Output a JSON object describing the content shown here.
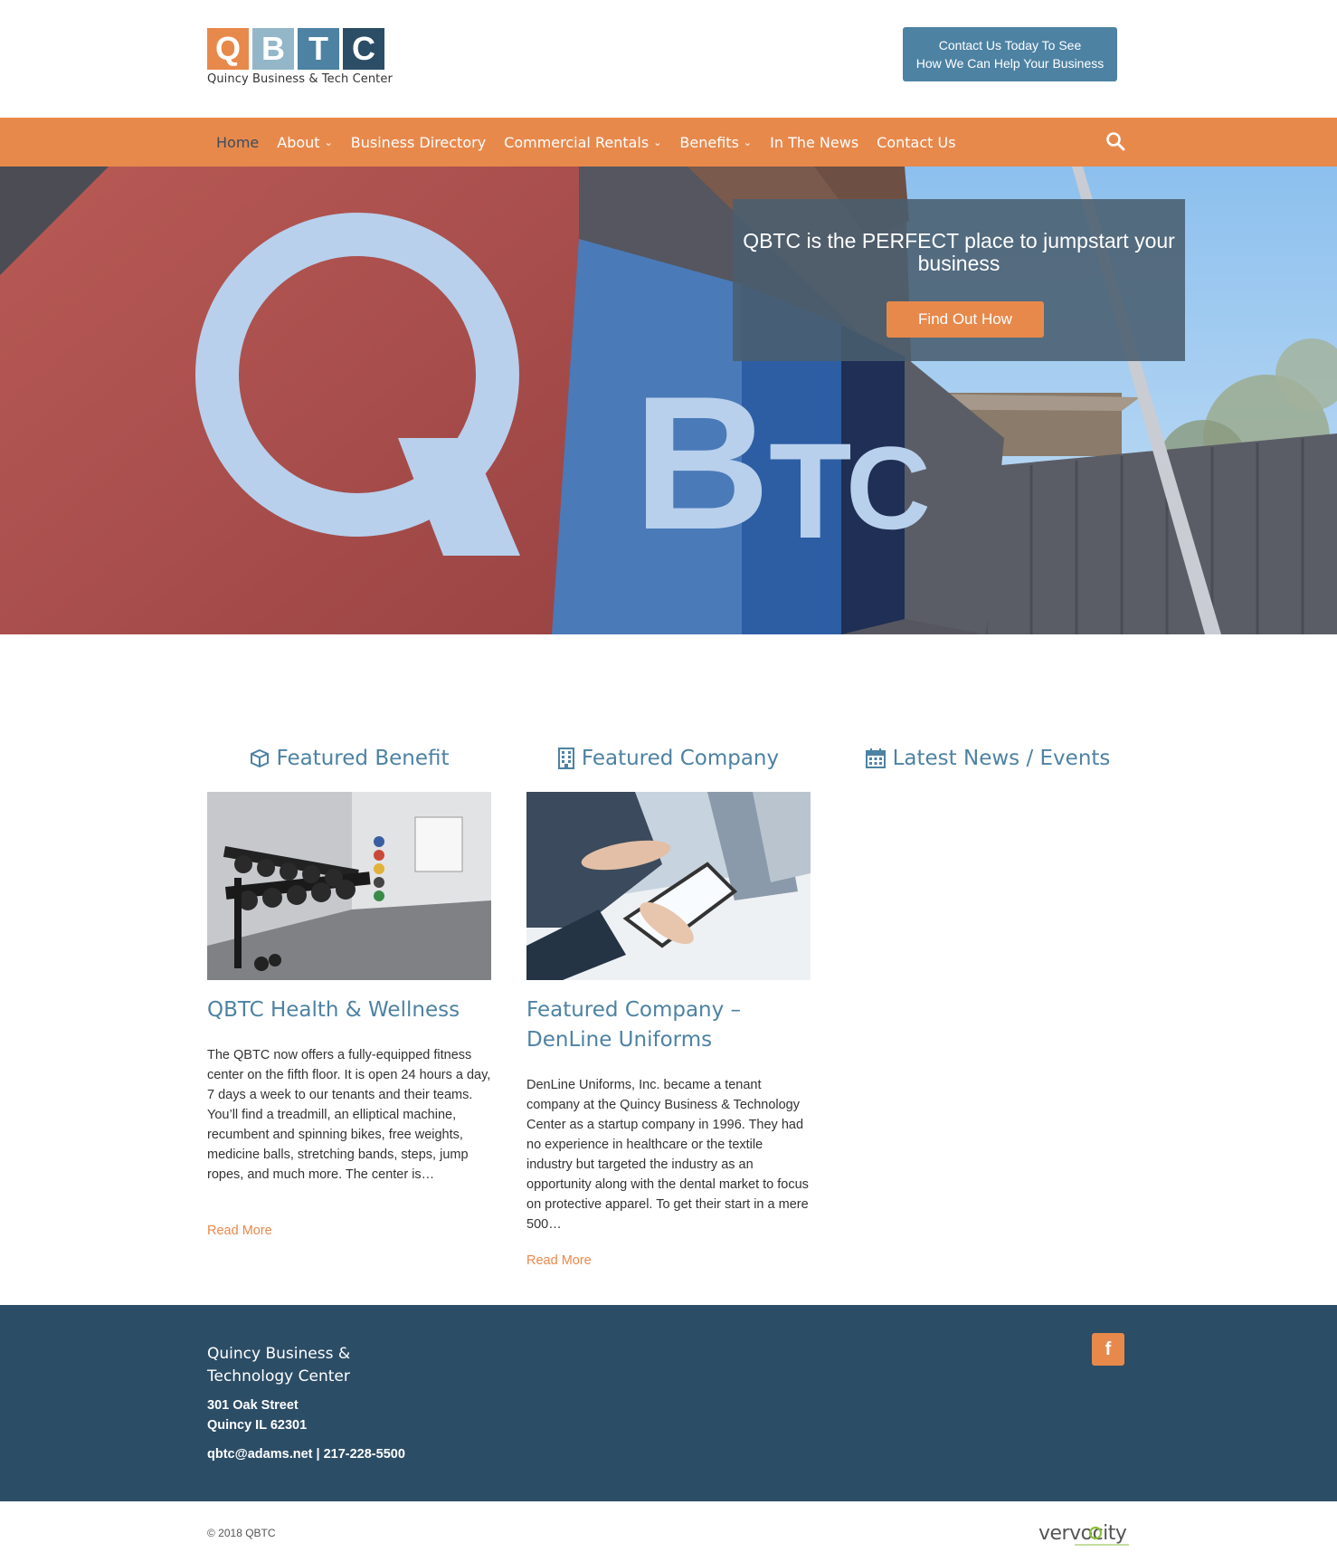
{
  "header": {
    "logo_letters": [
      "Q",
      "B",
      "T",
      "C"
    ],
    "logo_colors": [
      "#e8894c",
      "#93b7c9",
      "#4d82a3",
      "#2c4d66"
    ],
    "logo_subtitle": "Quincy Business & Tech Center",
    "cta_line1": "Contact Us Today To See",
    "cta_line2": "How We Can Help Your Business"
  },
  "nav": {
    "items": [
      {
        "label": "Home",
        "active": true
      },
      {
        "label": "About",
        "dropdown": true
      },
      {
        "label": "Business Directory"
      },
      {
        "label": "Commercial Rentals",
        "dropdown": true
      },
      {
        "label": "Benefits",
        "dropdown": true
      },
      {
        "label": "In The News"
      },
      {
        "label": "Contact Us"
      }
    ],
    "search_icon": "search-icon"
  },
  "hero": {
    "title": "QBTC is the PERFECT place to jumpstart your business",
    "button": "Find Out How",
    "sign_letters": [
      "Q",
      "B",
      "T",
      "C"
    ]
  },
  "columns": {
    "benefit": {
      "heading": "Featured Benefit",
      "icon": "cube-icon",
      "title": "QBTC Health & Wellness",
      "text": "The QBTC now offers a fully-equipped fitness center on the fifth floor. It is open 24 hours a day, 7 days a week to our tenants and their teams. You’ll find a treadmill, an elliptical machine, recumbent and spinning bikes, free weights, medicine balls, stretching bands, steps, jump ropes, and much more. The center is…",
      "read_more": "Read More"
    },
    "company": {
      "heading": "Featured Company",
      "icon": "building-icon",
      "title": "Featured Company – DenLine Uniforms",
      "text": "DenLine Uniforms, Inc. became a tenant company at the Quincy Business & Technology Center as a startup company in 1996. They had no experience in healthcare or the textile industry but targeted the industry as an opportunity along with the dental market to focus on protective apparel. To get their start in a mere 500…",
      "read_more": "Read More"
    },
    "news": {
      "heading": "Latest News / Events",
      "icon": "calendar-icon"
    }
  },
  "footer": {
    "name": "Quincy Business & Technology Center",
    "street": "301 Oak Street",
    "city": "Quincy IL 62301",
    "contact": "qbtc@adams.net | 217-228-5500",
    "social_icon": "f",
    "copyright": "© 2018 QBTC",
    "credit_logo": "vervocity"
  },
  "colors": {
    "accent_orange": "#e8894c",
    "brand_blue": "#4d82a3",
    "footer_navy": "#2c4d66"
  }
}
